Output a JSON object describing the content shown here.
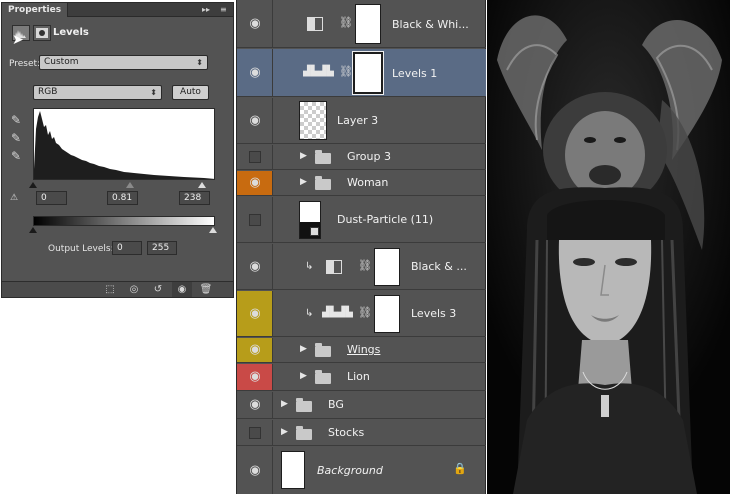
{
  "properties": {
    "tab_title": "Properties",
    "panel_title": "Levels",
    "preset_label": "Preset:",
    "preset_value": "Custom",
    "channel_value": "RGB",
    "auto_label": "Auto",
    "input_black": "0",
    "input_gamma": "0.81",
    "input_white": "238",
    "output_label": "Output Levels:",
    "output_black": "0",
    "output_white": "255"
  },
  "layers": [
    {
      "name": "Black & Whi..."
    },
    {
      "name": "Levels 1"
    },
    {
      "name": "Layer 3"
    },
    {
      "name": "Group 3"
    },
    {
      "name": "Woman"
    },
    {
      "name": "Dust-Particle (11)"
    },
    {
      "name": "Black & ..."
    },
    {
      "name": "Levels 3"
    },
    {
      "name": "Wings"
    },
    {
      "name": "Lion"
    },
    {
      "name": "BG"
    },
    {
      "name": "Stocks"
    },
    {
      "name": "Background"
    }
  ],
  "colors": {
    "panel": "#535353",
    "selected": "#5a6b85",
    "orange_tag": "#c86b10",
    "yellow_tag": "#b79d1a",
    "red_tag": "#c94a47"
  },
  "icons": [
    "levels-icon",
    "mask-icon",
    "eyedropper-icon",
    "eye-icon",
    "folder-icon",
    "link-icon",
    "lock-icon",
    "trash-icon"
  ]
}
